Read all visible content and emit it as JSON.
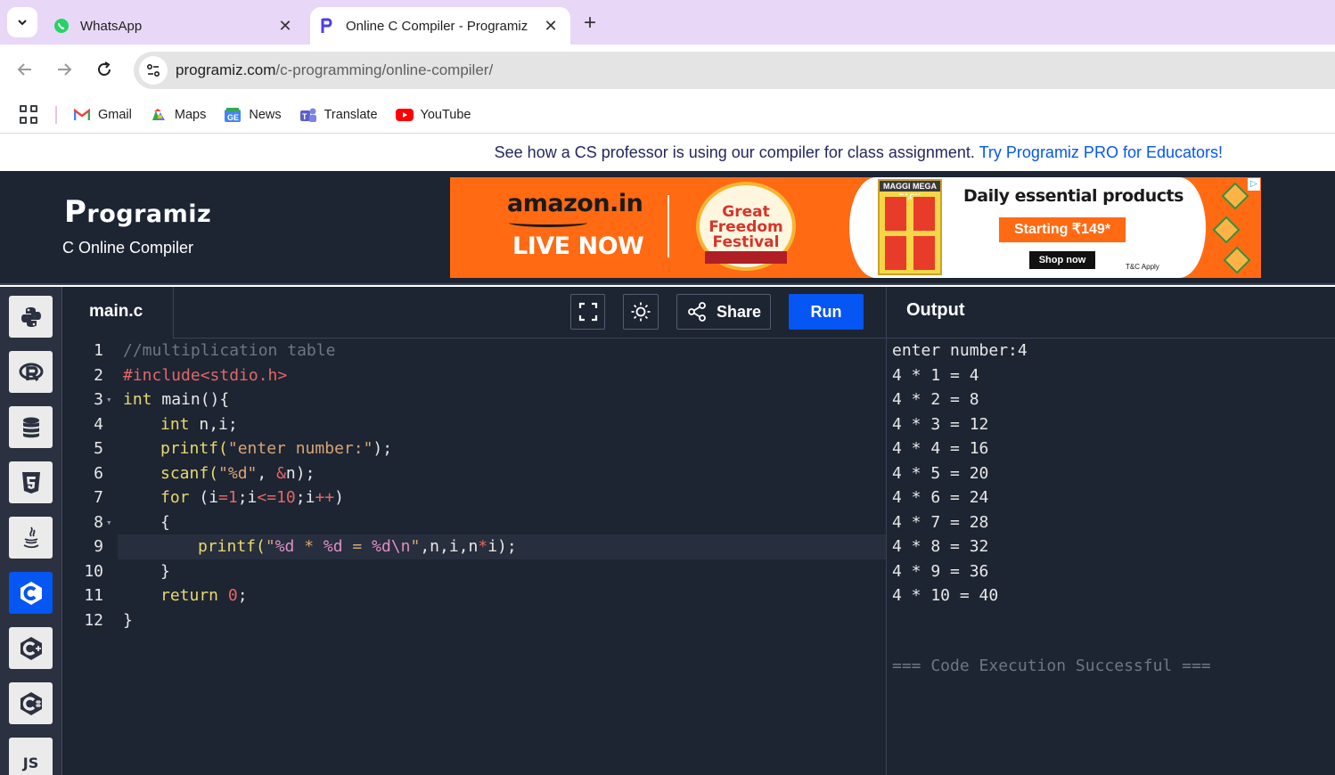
{
  "browser": {
    "tabs": [
      {
        "title": "WhatsApp",
        "active": false,
        "icon": "whatsapp-icon"
      },
      {
        "title": "Online C Compiler - Programiz",
        "active": true,
        "icon": "programiz-icon"
      }
    ],
    "close_glyph": "✕",
    "new_tab_glyph": "+",
    "url_host": "programiz.com",
    "url_path": "/c-programming/online-compiler/",
    "bookmarks": [
      {
        "label": "Gmail",
        "icon": "gmail-icon"
      },
      {
        "label": "Maps",
        "icon": "maps-icon"
      },
      {
        "label": "News",
        "icon": "news-icon"
      },
      {
        "label": "Translate",
        "icon": "translate-icon"
      },
      {
        "label": "YouTube",
        "icon": "youtube-icon"
      }
    ]
  },
  "promo": {
    "text": "See how a CS professor is using our compiler for class assignment.",
    "link": "Try Programiz PRO for Educators!"
  },
  "header": {
    "logo": "rogramiz",
    "logo_initial": "P",
    "subtitle": "C Online Compiler"
  },
  "ad": {
    "brand": "amazon.in",
    "live": "LIVE NOW",
    "badge_line1": "Great",
    "badge_line2": "Freedom",
    "badge_line3": "Festival",
    "pack_label": "MAGGI MEGA PACK",
    "headline": "Daily essential products",
    "price": "Starting ₹149*",
    "cta": "Shop now",
    "terms": "T&C Apply"
  },
  "sidebar": {
    "languages": [
      {
        "name": "python",
        "label": ""
      },
      {
        "name": "r",
        "label": ""
      },
      {
        "name": "sql",
        "label": ""
      },
      {
        "name": "html",
        "label": ""
      },
      {
        "name": "java",
        "label": ""
      },
      {
        "name": "c",
        "label": "C",
        "active": true
      },
      {
        "name": "cpp",
        "label": ""
      },
      {
        "name": "csharp",
        "label": ""
      },
      {
        "name": "js",
        "label": "JS"
      }
    ]
  },
  "editor": {
    "filename": "main.c",
    "share_label": "Share",
    "run_label": "Run",
    "line_numbers": [
      "1",
      "2",
      "3",
      "4",
      "5",
      "6",
      "7",
      "8",
      "9",
      "10",
      "11",
      "12"
    ],
    "fold_glyph": "▾",
    "code": {
      "l1": "//multiplication table",
      "l2": "#include<stdio.h>",
      "l3_kw": "int",
      "l3_rest": " main(){",
      "l4_kw": "int",
      "l4_rest": " n,i;",
      "l5_fn": "printf(",
      "l5_str": "\"enter number:\"",
      "l5_end": ");",
      "l6_fn": "scanf(",
      "l6_str": "\"%d\"",
      "l6_mid": ", ",
      "l6_amp": "&",
      "l6_end": "n);",
      "l7_kw": "for",
      "l7_a": " (i",
      "l7_eq": "=",
      "l7_one": "1",
      "l7_b": ";i",
      "l7_le": "<=",
      "l7_ten": "10",
      "l7_c": ";i",
      "l7_inc": "++",
      "l7_d": ")",
      "l8": "{",
      "l9_fn": "printf(",
      "l9_q1": "\"",
      "l9_f1": "%d",
      "l9_s1": " * ",
      "l9_f2": "%d",
      "l9_s2": " = ",
      "l9_f3": "%d\\n",
      "l9_q2": "\"",
      "l9_args": ",n,i,n",
      "l9_star": "*",
      "l9_end": "i);",
      "l10": "}",
      "l11_kw": "return",
      "l11_sp": " ",
      "l11_num": "0",
      "l11_end": ";",
      "l12": "}"
    }
  },
  "output": {
    "title": "Output",
    "lines": [
      "enter number:4",
      "4 * 1 = 4",
      "4 * 2 = 8",
      "4 * 3 = 12",
      "4 * 4 = 16",
      "4 * 5 = 20",
      "4 * 6 = 24",
      "4 * 7 = 28",
      "4 * 8 = 32",
      "4 * 9 = 36",
      "4 * 10 = 40"
    ],
    "status": "=== Code Execution Successful ==="
  }
}
